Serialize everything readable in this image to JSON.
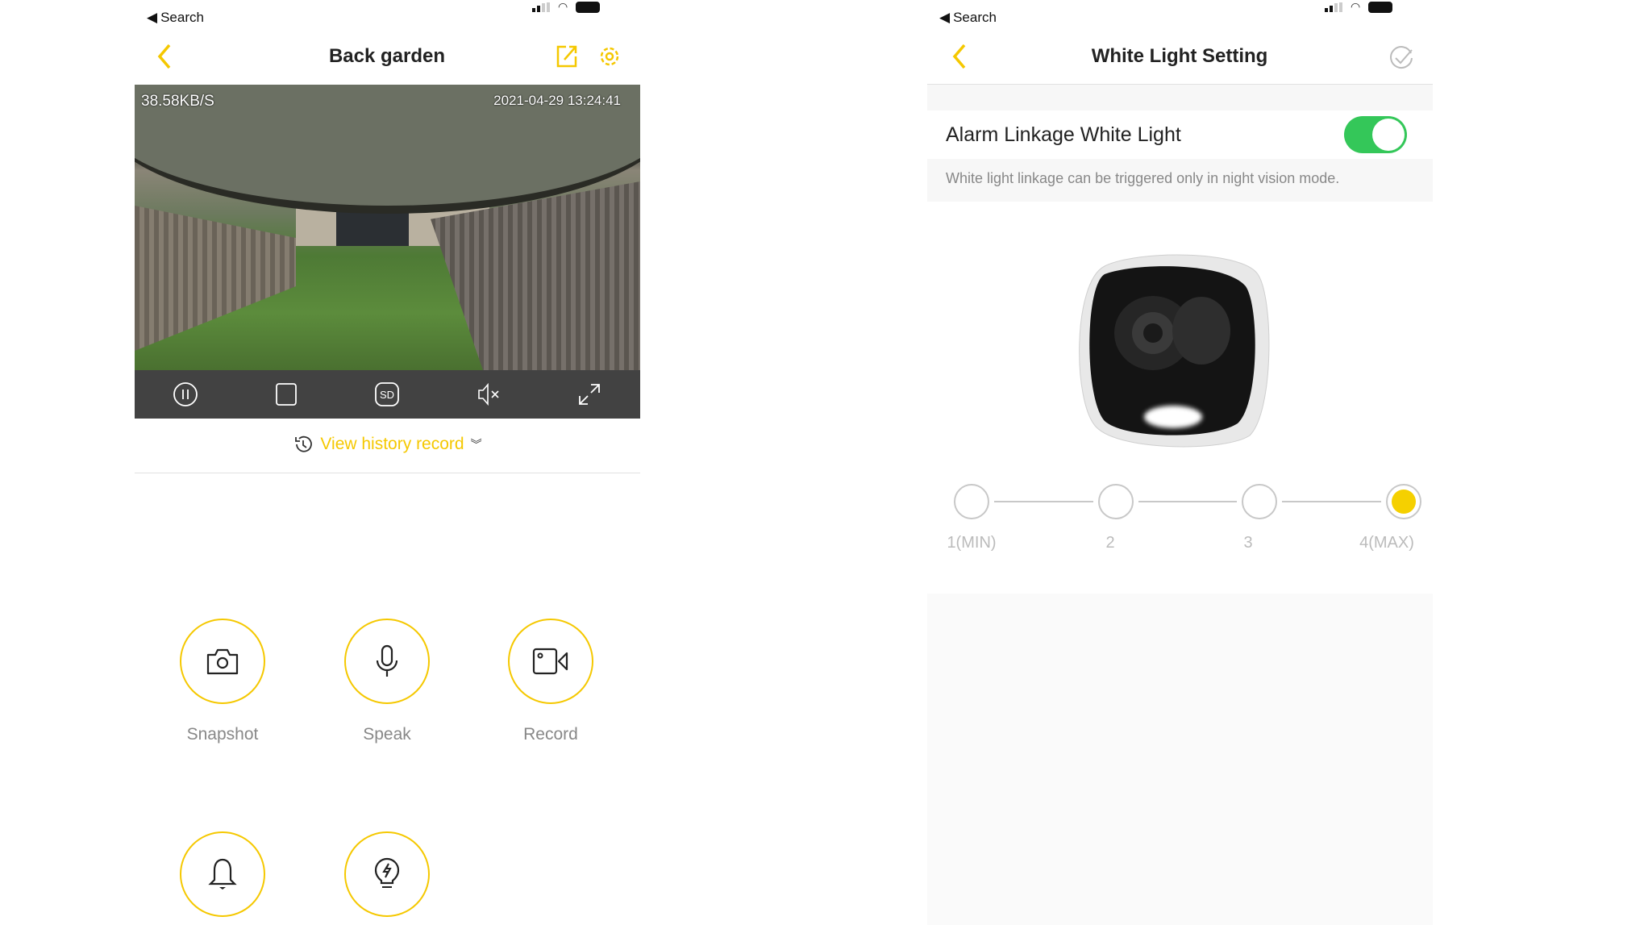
{
  "colors": {
    "accent": "#f5c800",
    "toggle_on": "#34c759",
    "control_bar": "#424242"
  },
  "left": {
    "status_back": "Search",
    "header": {
      "title": "Back garden",
      "back_icon": "chevron-left-icon",
      "share_icon": "share-icon",
      "settings_icon": "gear-icon"
    },
    "video": {
      "bitrate": "38.58KB/S",
      "timestamp": "2021-04-29 13:24:41"
    },
    "controls": [
      {
        "icon": "pause-icon"
      },
      {
        "icon": "stop-icon"
      },
      {
        "icon": "sd-icon",
        "label": "SD"
      },
      {
        "icon": "mute-icon"
      },
      {
        "icon": "fullscreen-icon"
      }
    ],
    "history": {
      "label": "View history record",
      "icon": "history-icon"
    },
    "functions": [
      {
        "label": "Snapshot",
        "icon": "camera-icon"
      },
      {
        "label": "Speak",
        "icon": "microphone-icon"
      },
      {
        "label": "Record",
        "icon": "video-camera-icon"
      },
      {
        "icon": "bell-icon"
      },
      {
        "icon": "lightbulb-icon"
      }
    ]
  },
  "right": {
    "status_back": "Search",
    "header": {
      "title": "White Light Setting",
      "back_icon": "chevron-left-icon",
      "confirm_icon": "check-circle-icon"
    },
    "alarm_linkage": {
      "label": "Alarm Linkage White Light",
      "enabled": true
    },
    "note": "White light linkage can be triggered only in night vision mode.",
    "brightness": {
      "levels": [
        "1(MIN)",
        "2",
        "3",
        "4(MAX)"
      ],
      "selected": 4
    }
  }
}
